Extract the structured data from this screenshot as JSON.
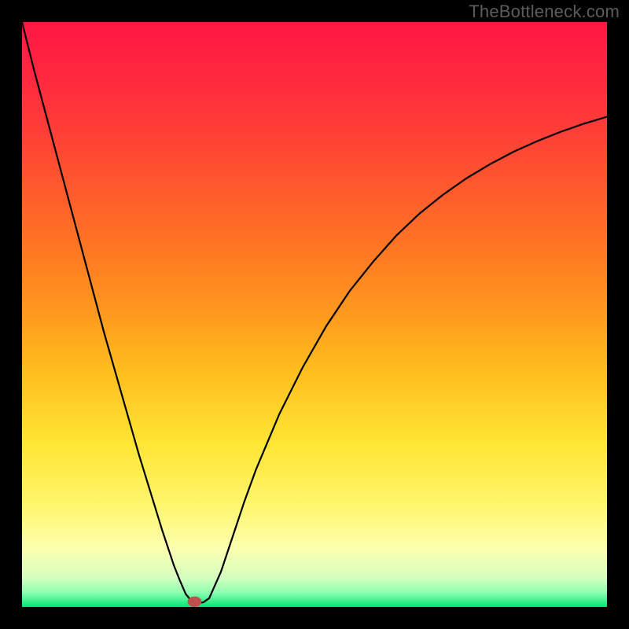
{
  "watermark": "TheBottleneck.com",
  "chart_data": {
    "type": "line",
    "title": "",
    "xlabel": "",
    "ylabel": "",
    "xlim": [
      0,
      100
    ],
    "ylim": [
      0,
      100
    ],
    "background_gradient": {
      "stops": [
        {
          "offset": 0.0,
          "color": "#ff1744"
        },
        {
          "offset": 0.1,
          "color": "#ff2a3f"
        },
        {
          "offset": 0.2,
          "color": "#ff4236"
        },
        {
          "offset": 0.3,
          "color": "#ff5e2b"
        },
        {
          "offset": 0.4,
          "color": "#ff7a23"
        },
        {
          "offset": 0.5,
          "color": "#ff9a1e"
        },
        {
          "offset": 0.6,
          "color": "#ffbf1e"
        },
        {
          "offset": 0.72,
          "color": "#ffe534"
        },
        {
          "offset": 0.82,
          "color": "#fff56a"
        },
        {
          "offset": 0.9,
          "color": "#fbffb0"
        },
        {
          "offset": 0.95,
          "color": "#d6ffbf"
        },
        {
          "offset": 0.975,
          "color": "#8fffb0"
        },
        {
          "offset": 1.0,
          "color": "#00e676"
        }
      ]
    },
    "series": [
      {
        "name": "bottleneck-curve",
        "color": "#000000",
        "stroke_width": 2.2,
        "x": [
          0,
          2,
          4,
          6,
          8,
          10,
          12,
          14,
          16,
          18,
          20,
          22,
          24,
          26,
          27,
          28,
          29,
          30,
          31,
          32,
          34,
          36,
          38,
          40,
          44,
          48,
          52,
          56,
          60,
          64,
          68,
          72,
          76,
          80,
          84,
          88,
          92,
          96,
          100
        ],
        "y": [
          100,
          92,
          84.5,
          77,
          69.5,
          62,
          54.5,
          47,
          40,
          33,
          26,
          19.5,
          13,
          7,
          4.5,
          2.2,
          1.0,
          0.7,
          0.8,
          1.5,
          6,
          12,
          18,
          23.5,
          33,
          41,
          48,
          54,
          59,
          63.5,
          67.3,
          70.5,
          73.3,
          75.7,
          77.8,
          79.6,
          81.2,
          82.6,
          83.8
        ]
      }
    ],
    "marker": {
      "name": "bottleneck-marker",
      "x": 29.5,
      "y": 0.9,
      "rx": 1.2,
      "ry": 0.9,
      "fill": "#c0504d"
    }
  }
}
